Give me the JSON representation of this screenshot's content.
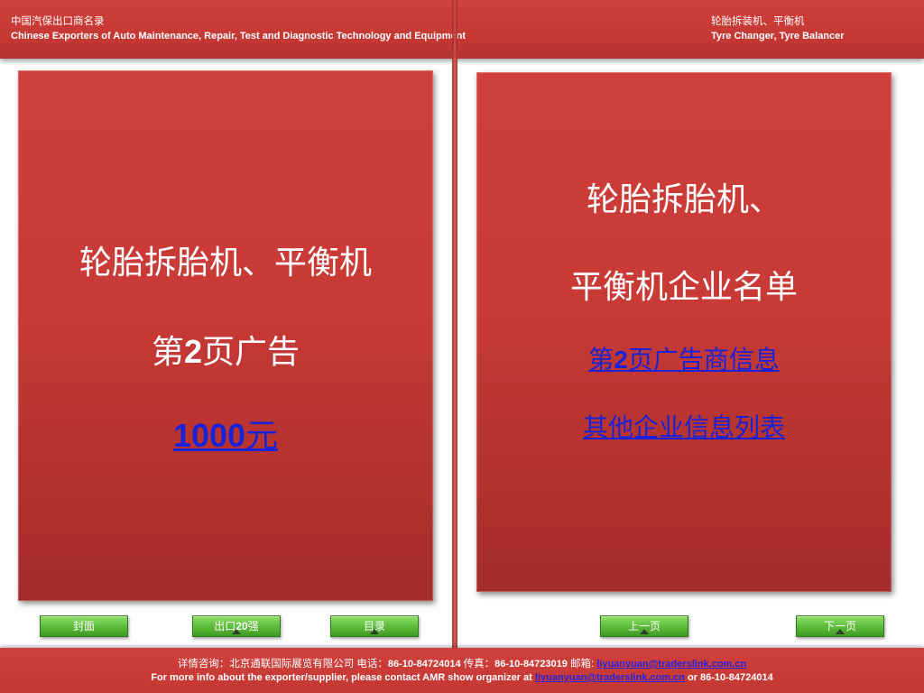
{
  "header": {
    "title_cn": "中国汽保出口商名录",
    "title_en": "Chinese Exporters of Auto Maintenance, Repair, Test and Diagnostic Technology and Equipment",
    "category_cn": "轮胎拆装机、平衡机",
    "category_en": "Tyre Changer, Tyre Balancer"
  },
  "left_panel": {
    "heading": "轮胎拆胎机、平衡机",
    "ad_prefix": "第",
    "ad_num": "2",
    "ad_suffix": "页广告",
    "price_num": "1000",
    "price_unit": "元"
  },
  "right_panel": {
    "heading_line1": "轮胎拆胎机、",
    "heading_line2": "平衡机企业名单",
    "link1_prefix": "第",
    "link1_num": "2",
    "link1_suffix": "页广告商信息",
    "link2": "其他企业信息列表"
  },
  "nav": {
    "cover": "封面",
    "top20_prefix": "出口",
    "top20_num": "20",
    "top20_suffix": "强",
    "contents": "目录",
    "prev": "上一页",
    "next": "下一页"
  },
  "footer": {
    "cn_label": "详情咨询：北京通联国际展览有限公司",
    "cn_tel_label": "电话：",
    "tel": "86-10-84724014",
    "cn_fax_label": "传真：",
    "fax": "86-10-84723019",
    "cn_email_label": "邮箱:",
    "email": "liyuanyuan@traderslink.com.cn",
    "en_prefix": "For more info about the exporter/supplier, please contact AMR show organizer at",
    "en_or": "or 86-10-84724014"
  },
  "colors": {
    "red_bar": "#c43733",
    "panel_red": "#c83a36",
    "link_blue": "#1a22d8",
    "button_green": "#5fbe3c"
  }
}
